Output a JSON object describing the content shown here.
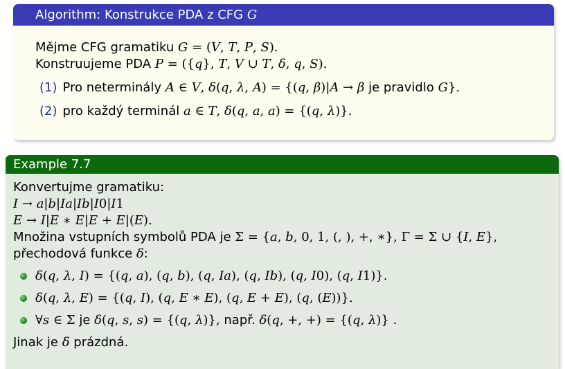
{
  "algorithm": {
    "title": "Algorithm: Konstrukce PDA z CFG G",
    "lines": [
      "Mějme CFG gramatiku G = (V, T, P, S).",
      "Konstruujeme PDA P = ({q}, T, V ∪ T, δ, q, S)."
    ],
    "items": [
      {
        "num": "(1)",
        "text": "Pro neterminály A ∈ V, δ(q, λ, A) = {(q, β)|A → β je pravidlo G}."
      },
      {
        "num": "(2)",
        "text": "pro každý terminál a ∈ T, δ(q, a, a) = {(q, λ)}."
      }
    ]
  },
  "example": {
    "title": "Example 7.7",
    "lines": [
      "Konvertujme gramatiku:",
      "I → a|b|Ia|Ib|I0|I1",
      "E → I|E ∗ E|E + E|(E).",
      "Množina vstupních symbolů PDA je Σ = {a, b, 0, 1, (, ), +, ∗}, Γ = Σ ∪ {I, E},",
      "přechodová funkce δ:"
    ],
    "bullets": [
      "δ(q, λ, I) = {(q, a), (q, b), (q, Ia), (q, Ib), (q, I0), (q, I1)}.",
      "δ(q, λ, E) = {(q, I), (q, E ∗ E), (q, E + E), (q, (E))}.",
      "∀s ∈ Σ je δ(q, s, s) = {(q, λ)}, např. δ(q, +, +) = {(q, λ)} ."
    ],
    "closing": "Jinak je δ prázdná."
  },
  "colors": {
    "algorithm_header": "#3a3ab4",
    "algorithm_body": "#fdfdf0",
    "example_header": "#0c6a0c",
    "example_body": "#e2ebe0",
    "enumeration": "#2c2ca8",
    "bullet": "#2e9a2e"
  }
}
